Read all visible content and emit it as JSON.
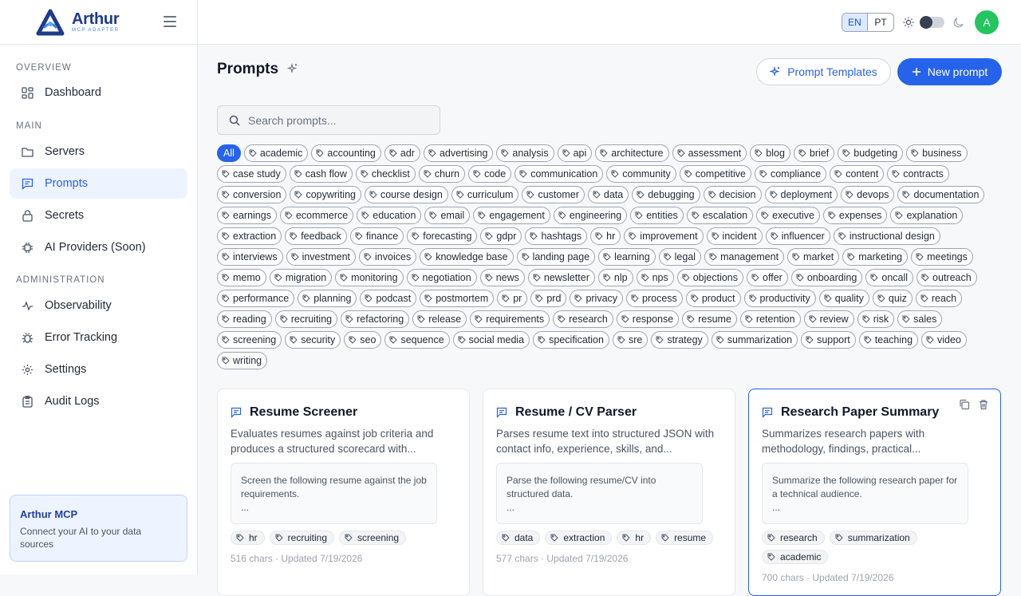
{
  "brand": {
    "title": "Arthur",
    "subtitle": "MCP ADAPTER"
  },
  "sidebar": {
    "sections": {
      "overview": "OVERVIEW",
      "main": "MAIN",
      "admin": "ADMINISTRATION"
    },
    "items": [
      {
        "label": "Dashboard",
        "icon": "dashboard-icon"
      },
      {
        "label": "Servers",
        "icon": "folder-icon"
      },
      {
        "label": "Prompts",
        "icon": "chat-icon"
      },
      {
        "label": "Secrets",
        "icon": "lock-icon"
      },
      {
        "label": "AI Providers (Soon)",
        "icon": "chip-icon"
      },
      {
        "label": "Observability",
        "icon": "activity-icon"
      },
      {
        "label": "Error Tracking",
        "icon": "bug-icon"
      },
      {
        "label": "Settings",
        "icon": "gear-icon"
      },
      {
        "label": "Audit Logs",
        "icon": "clipboard-icon"
      }
    ],
    "promo": {
      "title": "Arthur MCP",
      "text": "Connect your AI to your data sources"
    }
  },
  "topbar": {
    "lang_en": "EN",
    "lang_pt": "PT",
    "avatar": "A"
  },
  "page": {
    "title": "Prompts",
    "templates_button": "Prompt Templates",
    "new_button": "New prompt",
    "search_placeholder": "Search prompts..."
  },
  "filter_all": "All",
  "tags": [
    "academic",
    "accounting",
    "adr",
    "advertising",
    "analysis",
    "api",
    "architecture",
    "assessment",
    "blog",
    "brief",
    "budgeting",
    "business",
    "case study",
    "cash flow",
    "checklist",
    "churn",
    "code",
    "communication",
    "community",
    "competitive",
    "compliance",
    "content",
    "contracts",
    "conversion",
    "copywriting",
    "course design",
    "curriculum",
    "customer",
    "data",
    "debugging",
    "decision",
    "deployment",
    "devops",
    "documentation",
    "earnings",
    "ecommerce",
    "education",
    "email",
    "engagement",
    "engineering",
    "entities",
    "escalation",
    "executive",
    "expenses",
    "explanation",
    "extraction",
    "feedback",
    "finance",
    "forecasting",
    "gdpr",
    "hashtags",
    "hr",
    "improvement",
    "incident",
    "influencer",
    "instructional design",
    "interviews",
    "investment",
    "invoices",
    "knowledge base",
    "landing page",
    "learning",
    "legal",
    "management",
    "market",
    "marketing",
    "meetings",
    "memo",
    "migration",
    "monitoring",
    "negotiation",
    "news",
    "newsletter",
    "nlp",
    "nps",
    "objections",
    "offer",
    "onboarding",
    "oncall",
    "outreach",
    "performance",
    "planning",
    "podcast",
    "postmortem",
    "pr",
    "prd",
    "privacy",
    "process",
    "product",
    "productivity",
    "quality",
    "quiz",
    "reach",
    "reading",
    "recruiting",
    "refactoring",
    "release",
    "requirements",
    "research",
    "response",
    "resume",
    "retention",
    "review",
    "risk",
    "sales",
    "screening",
    "security",
    "seo",
    "sequence",
    "social media",
    "specification",
    "sre",
    "strategy",
    "summarization",
    "support",
    "teaching",
    "video",
    "writing"
  ],
  "cards": [
    {
      "title": "Resume Screener",
      "description": "Evaluates resumes against job criteria and produces a structured scorecard with...",
      "preview": "Screen the following resume against the job requirements.",
      "preview_more": "...",
      "tags": [
        "hr",
        "recruiting",
        "screening"
      ],
      "meta": "516 chars · Updated 7/19/2026"
    },
    {
      "title": "Resume / CV Parser",
      "description": "Parses resume text into structured JSON with contact info, experience, skills, and...",
      "preview": "Parse the following resume/CV into structured data.",
      "preview_more": "...",
      "tags": [
        "data",
        "extraction",
        "hr",
        "resume"
      ],
      "meta": "577 chars · Updated 7/19/2026"
    },
    {
      "title": "Research Paper Summary",
      "description": "Summarizes research papers with methodology, findings, practical...",
      "preview": "Summarize the following research paper for a technical audience.",
      "preview_more": "...",
      "tags": [
        "research",
        "summarization",
        "academic"
      ],
      "meta": "700 chars · Updated 7/19/2026"
    }
  ]
}
